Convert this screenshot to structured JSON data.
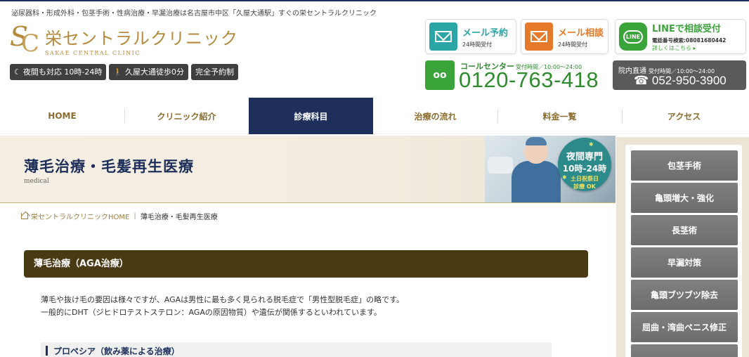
{
  "header": {
    "tagline": "泌尿器科・形成外科・包茎手術・性病治療・早漏治療は名古屋市中区「久屋大通駅」すぐの栄セントラルクリニック",
    "logo": {
      "mark_s": "S",
      "mark_c": "C",
      "name": "栄セントラルクリニック",
      "subtitle": "SAKAE CENTRAL CLINIC"
    },
    "badges": [
      {
        "icon": "moon-icon",
        "label": "夜間も対応 10時-24時"
      },
      {
        "icon": "walking-icon",
        "label": "久屋大通徒歩0分"
      },
      {
        "icon": "",
        "label": "完全予約制"
      }
    ],
    "contact": {
      "mail_reserve": {
        "title": "メール予約",
        "sub": "24時間受付",
        "color": "#2aa6a6"
      },
      "mail_consult": {
        "title": "メール相談",
        "sub": "24時間受付",
        "color": "#e57a2a"
      },
      "line": {
        "title": "LINEで相談受付",
        "sub": "電話番号検索:08081680442",
        "link": "詳しくはこちら ▸",
        "color": "#3aa33a",
        "icon_text": "LINE"
      },
      "callcenter": {
        "label": "コールセンター",
        "hours": "受付時間／10:00～24:00",
        "number": "0120-763-418",
        "icon_text": "oo"
      },
      "direct": {
        "label": "院内直通",
        "hours": "受付時間／10:00～24:00",
        "number": "☎ 052-950-3900"
      }
    }
  },
  "nav": {
    "items": [
      {
        "label": "HOME"
      },
      {
        "label": "クリニック紹介"
      },
      {
        "label": "診療科目"
      },
      {
        "label": "治療の流れ"
      },
      {
        "label": "料金一覧"
      },
      {
        "label": "アクセス"
      }
    ],
    "active_index": 2
  },
  "hero": {
    "title": "薄毛治療・毛髪再生医療",
    "subtitle": "medical",
    "night_badge": {
      "line1": "夜間専門",
      "line2": "10時-24時",
      "line3": "土日祝祭日",
      "line4": "診療 OK"
    }
  },
  "breadcrumb": {
    "home": "栄セントラルクリニックHOME",
    "sep": "|",
    "current": "薄毛治療・毛髪再生医療"
  },
  "main": {
    "section_title": "薄毛治療（AGA治療）",
    "paragraph": [
      "薄毛や抜け毛の要因は様々ですが、AGAは男性に最も多く見られる脱毛症で「男性型脱毛症」の略です。",
      "一般的にDHT（ジヒドロテストステロン：AGAの原因物質）や遺伝が関係するといわれています。"
    ],
    "sub_title": "プロペシア（飲み薬による治療）"
  },
  "sidebar": {
    "items": [
      {
        "label": "包茎手術"
      },
      {
        "label": "亀頭増大・強化"
      },
      {
        "label": "長茎術"
      },
      {
        "label": "早漏対策"
      },
      {
        "label": "亀頭ブツブツ除去"
      },
      {
        "label": "屈曲・湾曲ペニス修正"
      },
      {
        "label": ""
      }
    ]
  }
}
